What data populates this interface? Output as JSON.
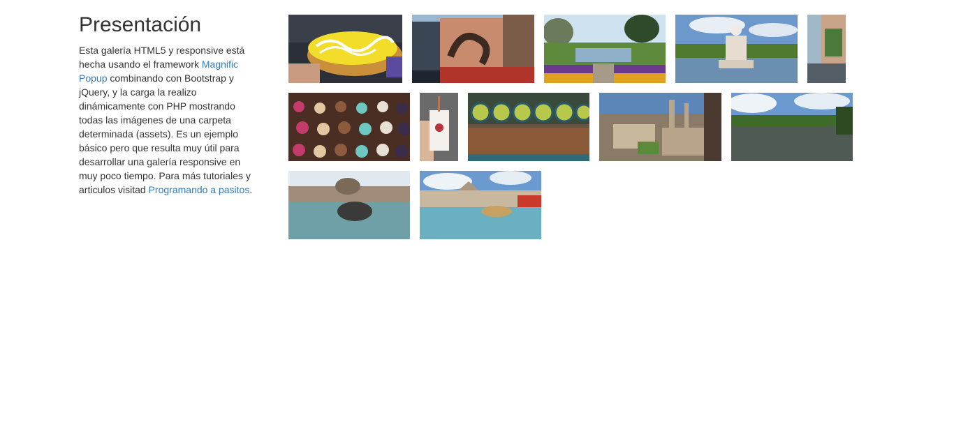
{
  "sidebar": {
    "title": "Presentación",
    "text_1": "Esta galería HTML5 y responsive está hecha usando el framework ",
    "link_1": "Magnific Popup",
    "text_2": " combinando con Bootstrap y jQuery, y la carga la realizo dinámicamente con PHP mostrando todas las imágenes de una carpeta determinada (assets). Es un ejemplo básico pero que resulta muy útil para desarrollar una galería responsive en muy poco tiempo. Para más tutoriales y articulos visitad ",
    "link_2": "Programando a pasitos",
    "text_3": "."
  },
  "gallery": {
    "images": [
      {
        "subject": "eclair"
      },
      {
        "subject": "camden-street"
      },
      {
        "subject": "sunken-garden"
      },
      {
        "subject": "queen-victoria-statue"
      },
      {
        "subject": "street-building"
      },
      {
        "subject": "cupcakes"
      },
      {
        "subject": "milkshake-cup"
      },
      {
        "subject": "market-stall"
      },
      {
        "subject": "oxford-college"
      },
      {
        "subject": "river"
      },
      {
        "subject": "trafalgar-fountain"
      },
      {
        "subject": "national-gallery"
      }
    ]
  }
}
